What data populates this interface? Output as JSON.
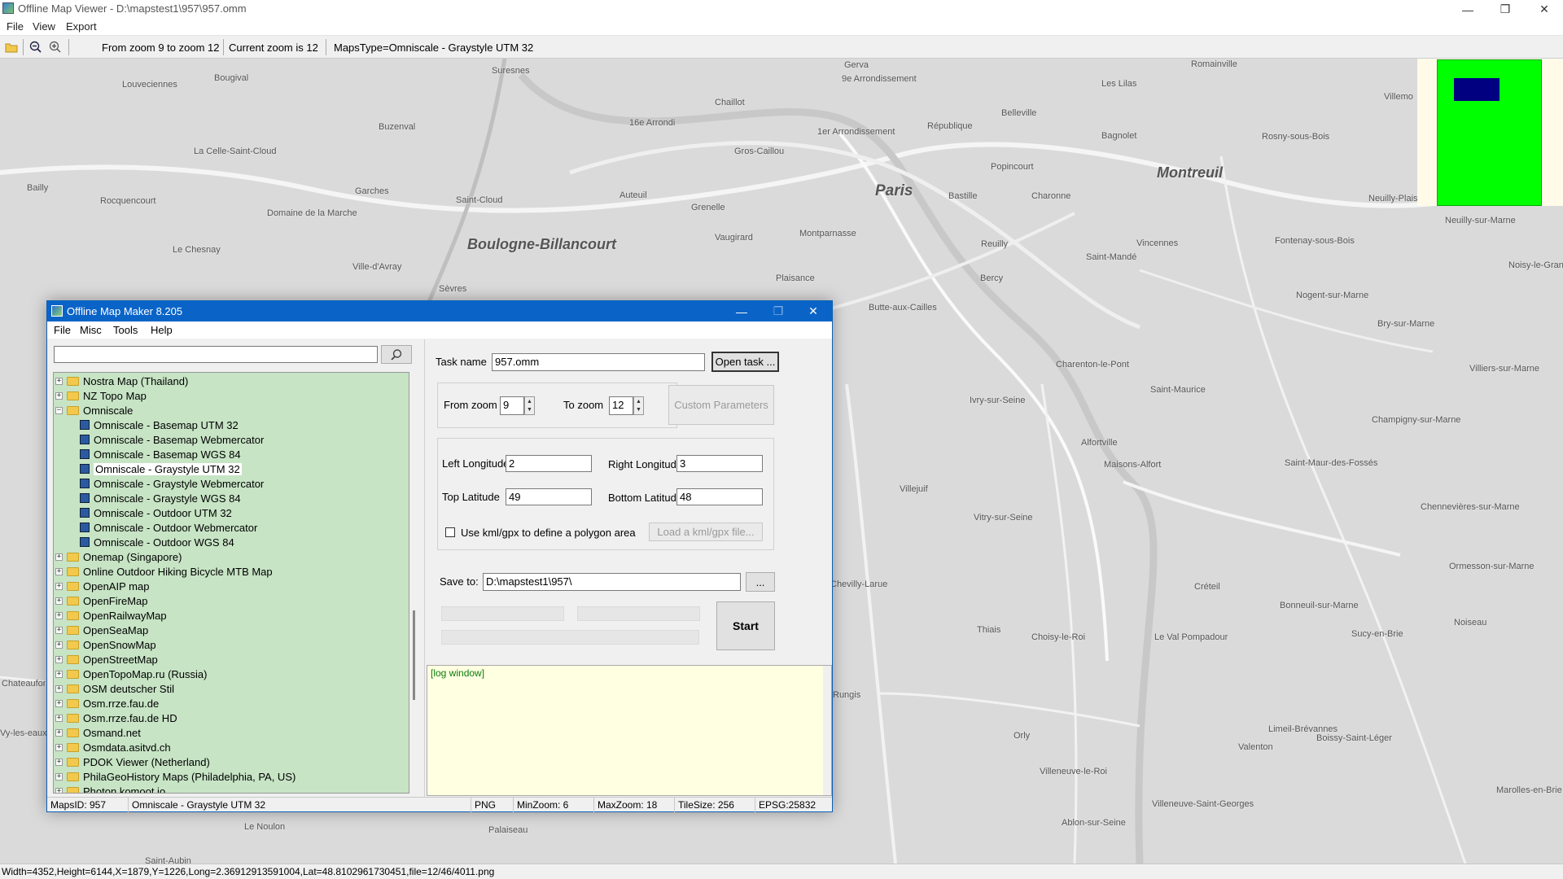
{
  "window": {
    "title": "Offline Map Viewer - D:\\mapstest1\\957\\957.omm",
    "min": "—",
    "max": "❐",
    "close": "✕"
  },
  "menu": {
    "file": "File",
    "view": "View",
    "export": "Export"
  },
  "toolbar": {
    "zoom_range": "From zoom 9 to zoom 12",
    "current_zoom": "Current zoom is 12",
    "maps_type": "MapsType=Omniscale - Graystyle UTM 32"
  },
  "map_labels": [
    "Louveciennes",
    "Bougival",
    "Suresnes",
    "Gerva",
    "Romainville",
    "Les Lilas",
    "9e Arrondissement",
    "Chaillot",
    "16e Arrondi",
    "1er Arrondissement",
    "République",
    "Belleville",
    "Bagnolet",
    "Rosny-sous-Bois",
    "Villemo",
    "Buzenval",
    "La Celle-Saint-Cloud",
    "Bailly",
    "Rocquencourt",
    "Garches",
    "Saint-Cloud",
    "Domaine de la Marche",
    "Le Chesnay",
    "Ville-d'Avray",
    "Sèvres",
    "Auteuil",
    "Grenelle",
    "Gros-Caillou",
    "Vaugirard",
    "Montparnasse",
    "Plaisance",
    "Bastille",
    "Popincourt",
    "Charonne",
    "Reuilly",
    "Bercy",
    "Vincennes",
    "Saint-Mandé",
    "Fontenay-sous-Bois",
    "Neuilly-Plaisance",
    "Neuilly-sur-Marne",
    "Noisy-le-Grand",
    "Nogent-sur-Marne",
    "Bry-sur-Marne",
    "Villiers-sur-Marne",
    "Champigny-sur-Marne",
    "Saint-Maur-des-Fossés",
    "Chennevières-sur-Marne",
    "Ormesson-sur-Marne",
    "Sucy-en-Brie",
    "Noiseau",
    "Boissy-Saint-Léger",
    "Bonneuil-sur-Marne",
    "Créteil",
    "Maisons-Alfort",
    "Alfortville",
    "Charenton-le-Pont",
    "Saint-Maurice",
    "Ivry-sur-Seine",
    "Vitry-sur-Seine",
    "Villejuif",
    "Butte-aux-Cailles",
    "Thiais",
    "Choisy-le-Roi",
    "Le Val Pompadour",
    "Valenton",
    "Limeil-Brévannes",
    "Orly",
    "Villeneuve-le-Roi",
    "Villeneuve-Saint-Georges",
    "Ablon-sur-Seine",
    "Marolles-en-Brie",
    "Rungis",
    "Chevilly-Larue",
    "Le Noulon",
    "Palaiseau",
    "Chateaufor",
    "Vy-les-eaux",
    "Saint-Aubin"
  ],
  "map_big": {
    "paris": "Paris",
    "boulogne": "Boulogne-Billancourt",
    "montreuil": "Montreuil"
  },
  "statusbar": "Width=4352,Height=6144,X=1879,Y=1226,Long=2.36912913591004,Lat=48.8102961730451,file=12/46/4011.png",
  "dialog": {
    "title": "Offline Map Maker 8.205",
    "menu": [
      "File",
      "Misc",
      "Tools",
      "Help"
    ],
    "search_placeholder": "",
    "tree": [
      {
        "label": "Nostra Map (Thailand)",
        "type": "folder",
        "exp": "+"
      },
      {
        "label": "NZ Topo Map",
        "type": "folder",
        "exp": "+"
      },
      {
        "label": "Omniscale",
        "type": "folder",
        "exp": "−",
        "open": true
      },
      {
        "label": "Omniscale - Basemap UTM 32",
        "type": "map"
      },
      {
        "label": "Omniscale - Basemap Webmercator",
        "type": "map"
      },
      {
        "label": "Omniscale - Basemap WGS 84",
        "type": "map"
      },
      {
        "label": "Omniscale - Graystyle UTM 32",
        "type": "map",
        "selected": true
      },
      {
        "label": "Omniscale - Graystyle Webmercator",
        "type": "map"
      },
      {
        "label": "Omniscale - Graystyle WGS 84",
        "type": "map"
      },
      {
        "label": "Omniscale - Outdoor UTM 32",
        "type": "map"
      },
      {
        "label": "Omniscale - Outdoor Webmercator",
        "type": "map"
      },
      {
        "label": "Omniscale - Outdoor WGS 84",
        "type": "map"
      },
      {
        "label": "Onemap (Singapore)",
        "type": "folder",
        "exp": "+"
      },
      {
        "label": "Online Outdoor Hiking Bicycle MTB Map",
        "type": "folder",
        "exp": "+"
      },
      {
        "label": "OpenAIP map",
        "type": "folder",
        "exp": "+"
      },
      {
        "label": "OpenFireMap",
        "type": "folder",
        "exp": "+"
      },
      {
        "label": "OpenRailwayMap",
        "type": "folder",
        "exp": "+"
      },
      {
        "label": "OpenSeaMap",
        "type": "folder",
        "exp": "+"
      },
      {
        "label": "OpenSnowMap",
        "type": "folder",
        "exp": "+"
      },
      {
        "label": "OpenStreetMap",
        "type": "folder",
        "exp": "+"
      },
      {
        "label": "OpenTopoMap.ru (Russia)",
        "type": "folder",
        "exp": "+"
      },
      {
        "label": "OSM deutscher Stil",
        "type": "folder",
        "exp": "+"
      },
      {
        "label": "Osm.rrze.fau.de",
        "type": "folder",
        "exp": "+"
      },
      {
        "label": "Osm.rrze.fau.de HD",
        "type": "folder",
        "exp": "+"
      },
      {
        "label": "Osmand.net",
        "type": "folder",
        "exp": "+"
      },
      {
        "label": "Osmdata.asitvd.ch",
        "type": "folder",
        "exp": "+"
      },
      {
        "label": "PDOK Viewer (Netherland)",
        "type": "folder",
        "exp": "+"
      },
      {
        "label": "PhilaGeoHistory Maps (Philadelphia, PA, US)",
        "type": "folder",
        "exp": "+"
      },
      {
        "label": "Photon.komoot.io",
        "type": "folder",
        "exp": "+"
      }
    ],
    "task_name_label": "Task name",
    "task_name": "957.omm",
    "open_task": "Open task ...",
    "from_zoom_label": "From zoom",
    "from_zoom": "9",
    "to_zoom_label": "To zoom",
    "to_zoom": "12",
    "custom_params": "Custom Parameters",
    "left_lon_label": "Left Longitude",
    "left_lon": "2",
    "right_lon_label": "Right Longitude",
    "right_lon": "3",
    "top_lat_label": "Top Latitude",
    "top_lat": "49",
    "bottom_lat_label": "Bottom Latitude",
    "bottom_lat": "48",
    "kml_label": "Use kml/gpx to define a polygon area",
    "load_kml": "Load a kml/gpx file...",
    "save_label": "Save to:",
    "save_path": "D:\\mapstest1\\957\\",
    "browse": "...",
    "start": "Start",
    "log": "[log window]",
    "status": {
      "mapsid": "MapsID: 957",
      "name": "Omniscale - Graystyle UTM 32",
      "format": "PNG",
      "minzoom": "MinZoom: 6",
      "maxzoom": "MaxZoom: 18",
      "tilesize": "TileSize: 256",
      "epsg": "EPSG:25832"
    }
  },
  "colors": {
    "accent": "#0a64c8",
    "tree_bg": "#c7e4c5",
    "log_bg": "#ffffe1",
    "overview_green": "#00ff00",
    "overview_box": "#000080"
  }
}
